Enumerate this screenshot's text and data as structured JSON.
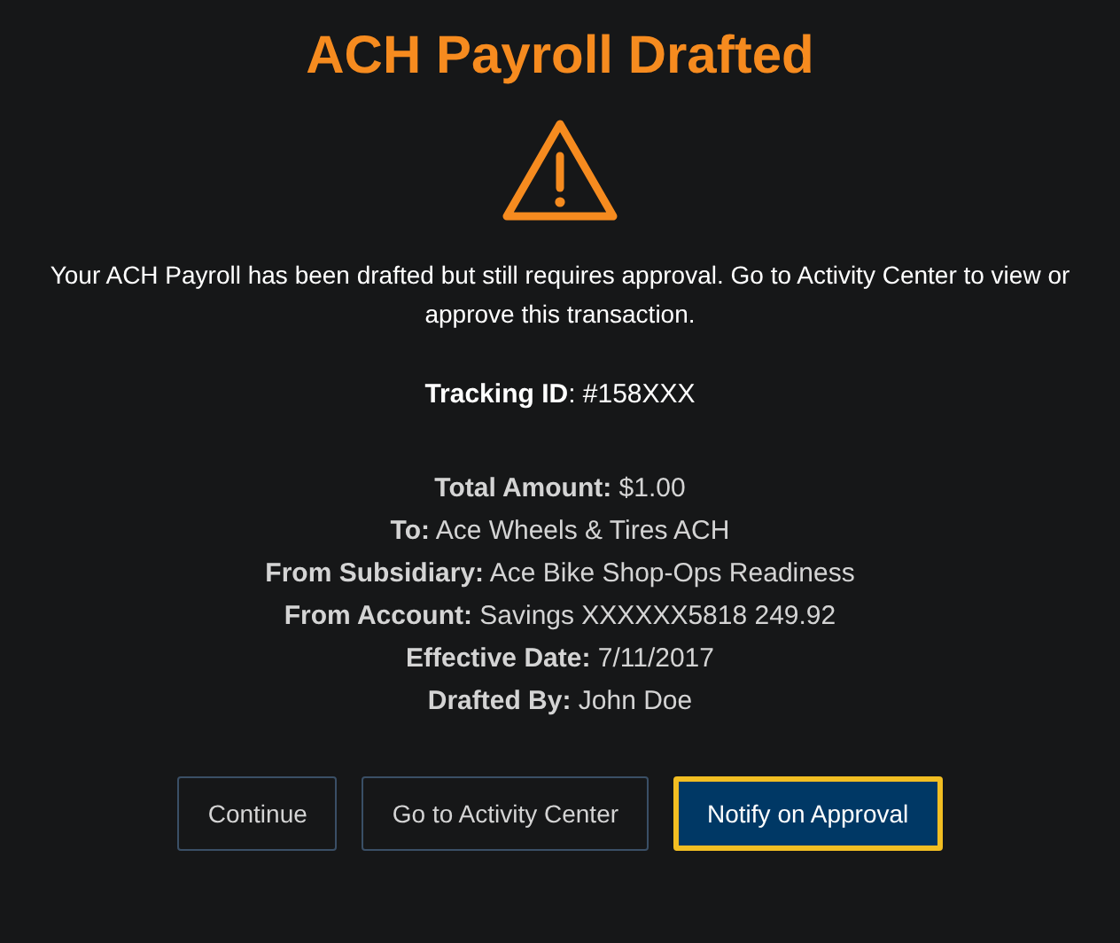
{
  "title": "ACH Payroll Drafted",
  "message": "Your ACH Payroll has been drafted but still requires approval. Go to Activity Center to view or approve this transaction.",
  "tracking": "**Tracking ID**: #158XXX",
  "details": [
    {
      "text": "**Total Amount:** $1.00"
    },
    {
      "text": "**To:** Ace Wheels & Tires ACH"
    },
    {
      "text": "**From Subsidiary:** Ace Bike Shop-Ops Readiness"
    },
    {
      "text": "**From Account:** Savings XXXXXX5818 249.92"
    },
    {
      "text": "**Effective Date:** 7/11/2017"
    },
    {
      "text": "**Drafted By:** John Doe"
    }
  ],
  "buttons": [
    {
      "label": "Continue",
      "kind": "secondary",
      "focused": false
    },
    {
      "label": "Go to Activity Center",
      "kind": "secondary",
      "focused": false
    },
    {
      "label": "Notify on Approval",
      "kind": "primary",
      "focused": true
    }
  ]
}
